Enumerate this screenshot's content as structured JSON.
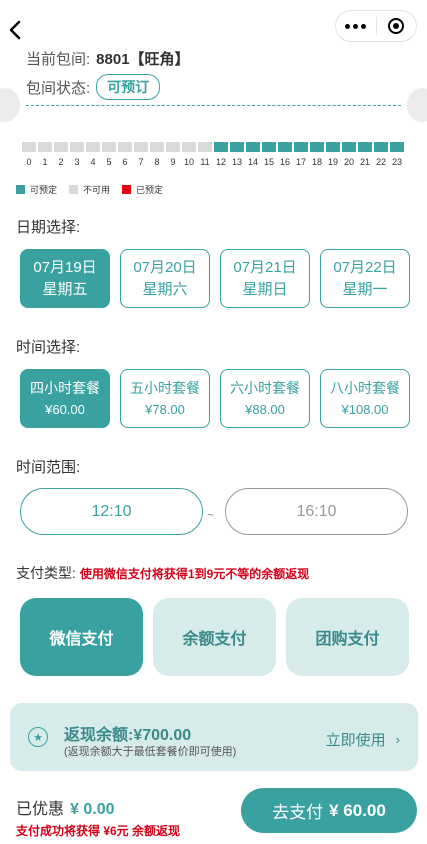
{
  "nav": {
    "back_icon": "chevron-left-icon",
    "menu_icon": "more-dots-icon",
    "close_icon": "record-circle-icon"
  },
  "room": {
    "label": "当前包间:",
    "value": "8801【旺角】",
    "status_label": "包间状态:",
    "status_value": "可预订"
  },
  "hours": [
    {
      "h": "0",
      "s": "unavailable"
    },
    {
      "h": "1",
      "s": "unavailable"
    },
    {
      "h": "2",
      "s": "unavailable"
    },
    {
      "h": "3",
      "s": "unavailable"
    },
    {
      "h": "4",
      "s": "unavailable"
    },
    {
      "h": "5",
      "s": "unavailable"
    },
    {
      "h": "6",
      "s": "unavailable"
    },
    {
      "h": "7",
      "s": "unavailable"
    },
    {
      "h": "8",
      "s": "unavailable"
    },
    {
      "h": "9",
      "s": "unavailable"
    },
    {
      "h": "10",
      "s": "unavailable"
    },
    {
      "h": "11",
      "s": "unavailable"
    },
    {
      "h": "12",
      "s": "available"
    },
    {
      "h": "13",
      "s": "available"
    },
    {
      "h": "14",
      "s": "available"
    },
    {
      "h": "15",
      "s": "available"
    },
    {
      "h": "16",
      "s": "available"
    },
    {
      "h": "17",
      "s": "available"
    },
    {
      "h": "18",
      "s": "available"
    },
    {
      "h": "19",
      "s": "available"
    },
    {
      "h": "20",
      "s": "available"
    },
    {
      "h": "21",
      "s": "available"
    },
    {
      "h": "22",
      "s": "available"
    },
    {
      "h": "23",
      "s": "available"
    }
  ],
  "legend": [
    {
      "label": "可预定",
      "color": "#3aa1a1"
    },
    {
      "label": "不可用",
      "color": "#d9d9d9"
    },
    {
      "label": "已预定",
      "color": "#e60012"
    }
  ],
  "date_section": {
    "title": "日期选择:",
    "options": [
      {
        "date": "07月19日",
        "weekday": "星期五",
        "selected": true
      },
      {
        "date": "07月20日",
        "weekday": "星期六",
        "selected": false
      },
      {
        "date": "07月21日",
        "weekday": "星期日",
        "selected": false
      },
      {
        "date": "07月22日",
        "weekday": "星期一",
        "selected": false
      }
    ]
  },
  "time_section": {
    "title": "时间选择:",
    "options": [
      {
        "name": "四小时套餐",
        "price": "¥60.00",
        "selected": true
      },
      {
        "name": "五小时套餐",
        "price": "¥78.00",
        "selected": false
      },
      {
        "name": "六小时套餐",
        "price": "¥88.00",
        "selected": false
      },
      {
        "name": "八小时套餐",
        "price": "¥108.00",
        "selected": false
      }
    ]
  },
  "range_section": {
    "title": "时间范围:",
    "start": "12:10",
    "separator": "~",
    "end": "16:10"
  },
  "payment": {
    "label": "支付类型:",
    "note": "使用微信支付将获得1到9元不等的余额返现",
    "methods": [
      {
        "label": "微信支付",
        "selected": true
      },
      {
        "label": "余额支付",
        "selected": false
      },
      {
        "label": "团购支付",
        "selected": false
      }
    ]
  },
  "cashback": {
    "icon": "star-badge-icon",
    "title": "返现余额:¥700.00",
    "subtitle": "(返现余额大于最低套餐价即可使用)",
    "action": "立即使用",
    "action_icon": "chevron-right-icon"
  },
  "footer": {
    "discount_label": "已优惠",
    "discount_amount": "¥ 0.00",
    "reward_note": "支付成功将获得 ¥6元 余额返现",
    "pay_label": "去支付",
    "pay_amount": "¥ 60.00"
  },
  "colors": {
    "accent": "#3aa1a1",
    "accent_light": "#d7ebeb",
    "warning": "#d0021b"
  }
}
